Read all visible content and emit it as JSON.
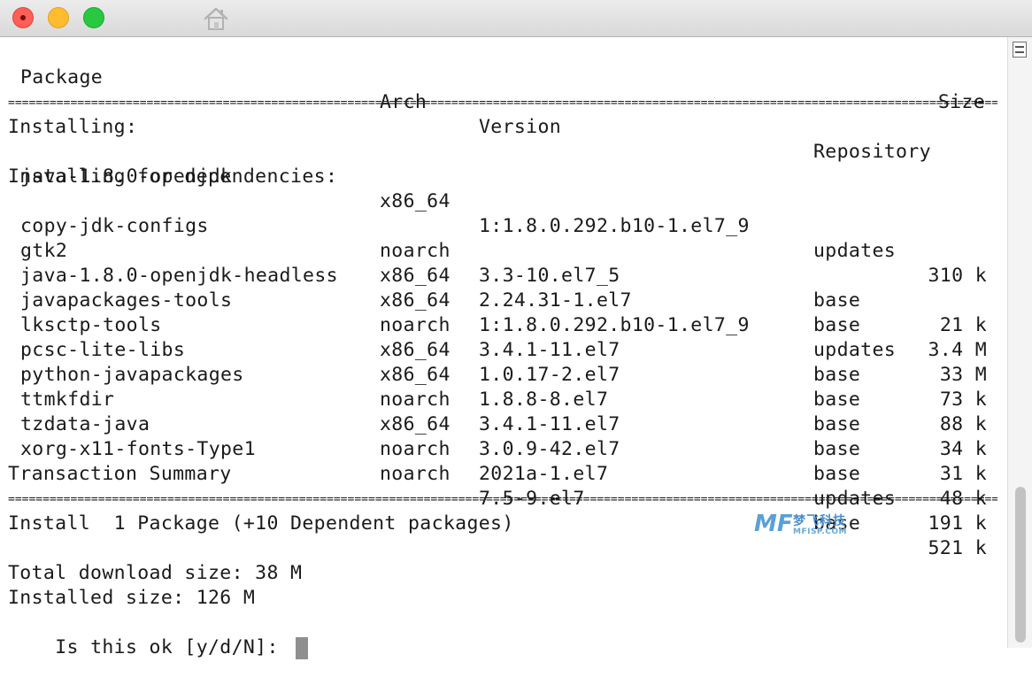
{
  "window": {
    "controls": [
      "close",
      "minimize",
      "zoom"
    ],
    "toolbar_icon": "home-icon"
  },
  "table": {
    "headers": {
      "package": "Package",
      "arch": "Arch",
      "version": "Version",
      "repository": "Repository",
      "size": "Size"
    },
    "separator": "=================================================================================================================================================",
    "groups": [
      {
        "label": "Installing:",
        "rows": [
          {
            "package": "java-1.8.0-openjdk",
            "arch": "x86_64",
            "version": "1:1.8.0.292.b10-1.el7_9",
            "repository": "updates",
            "size": "310 k"
          }
        ]
      },
      {
        "label": "Installing for dependencies:",
        "rows": [
          {
            "package": "copy-jdk-configs",
            "arch": "noarch",
            "version": "3.3-10.el7_5",
            "repository": "base",
            "size": "21 k"
          },
          {
            "package": "gtk2",
            "arch": "x86_64",
            "version": "2.24.31-1.el7",
            "repository": "base",
            "size": "3.4 M"
          },
          {
            "package": "java-1.8.0-openjdk-headless",
            "arch": "x86_64",
            "version": "1:1.8.0.292.b10-1.el7_9",
            "repository": "updates",
            "size": "33 M"
          },
          {
            "package": "javapackages-tools",
            "arch": "noarch",
            "version": "3.4.1-11.el7",
            "repository": "base",
            "size": "73 k"
          },
          {
            "package": "lksctp-tools",
            "arch": "x86_64",
            "version": "1.0.17-2.el7",
            "repository": "base",
            "size": "88 k"
          },
          {
            "package": "pcsc-lite-libs",
            "arch": "x86_64",
            "version": "1.8.8-8.el7",
            "repository": "base",
            "size": "34 k"
          },
          {
            "package": "python-javapackages",
            "arch": "noarch",
            "version": "3.4.1-11.el7",
            "repository": "base",
            "size": "31 k"
          },
          {
            "package": "ttmkfdir",
            "arch": "x86_64",
            "version": "3.0.9-42.el7",
            "repository": "base",
            "size": "48 k"
          },
          {
            "package": "tzdata-java",
            "arch": "noarch",
            "version": "2021a-1.el7",
            "repository": "updates",
            "size": "191 k"
          },
          {
            "package": "xorg-x11-fonts-Type1",
            "arch": "noarch",
            "version": "7.5-9.el7",
            "repository": "base",
            "size": "521 k"
          }
        ]
      }
    ]
  },
  "summary": {
    "title": "Transaction Summary",
    "install_line": "Install  1 Package (+10 Dependent packages)",
    "total_download": "Total download size: 38 M",
    "installed_size": "Installed size: 126 M",
    "prompt": "Is this ok [y/d/N]: "
  },
  "watermark": {
    "logo": "MF",
    "text_cn": "梦飞科技",
    "text_en": "MFISP.COM"
  }
}
